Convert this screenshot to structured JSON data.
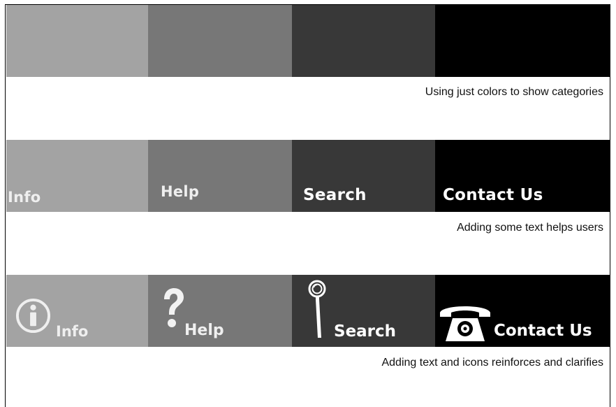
{
  "rows": [
    {
      "caption": "Using just colors to show categories",
      "tiles": [
        {
          "color": "#a3a3a3"
        },
        {
          "color": "#777777"
        },
        {
          "color": "#383838"
        },
        {
          "color": "#000000"
        }
      ]
    },
    {
      "caption": "Adding some text helps users",
      "tiles": [
        {
          "label": "Info",
          "color": "#a3a3a3"
        },
        {
          "label": "Help",
          "color": "#777777"
        },
        {
          "label": "Search",
          "color": "#383838"
        },
        {
          "label": "Contact Us",
          "color": "#000000"
        }
      ]
    },
    {
      "caption": "Adding text and icons reinforces and clarifies",
      "tiles": [
        {
          "label": "Info",
          "icon": "info-icon",
          "color": "#a3a3a3"
        },
        {
          "label": "Help",
          "icon": "question-mark-icon",
          "color": "#777777"
        },
        {
          "label": "Search",
          "icon": "magnifying-glass-icon",
          "color": "#383838"
        },
        {
          "label": "Contact Us",
          "icon": "telephone-icon",
          "color": "#000000"
        }
      ]
    }
  ]
}
